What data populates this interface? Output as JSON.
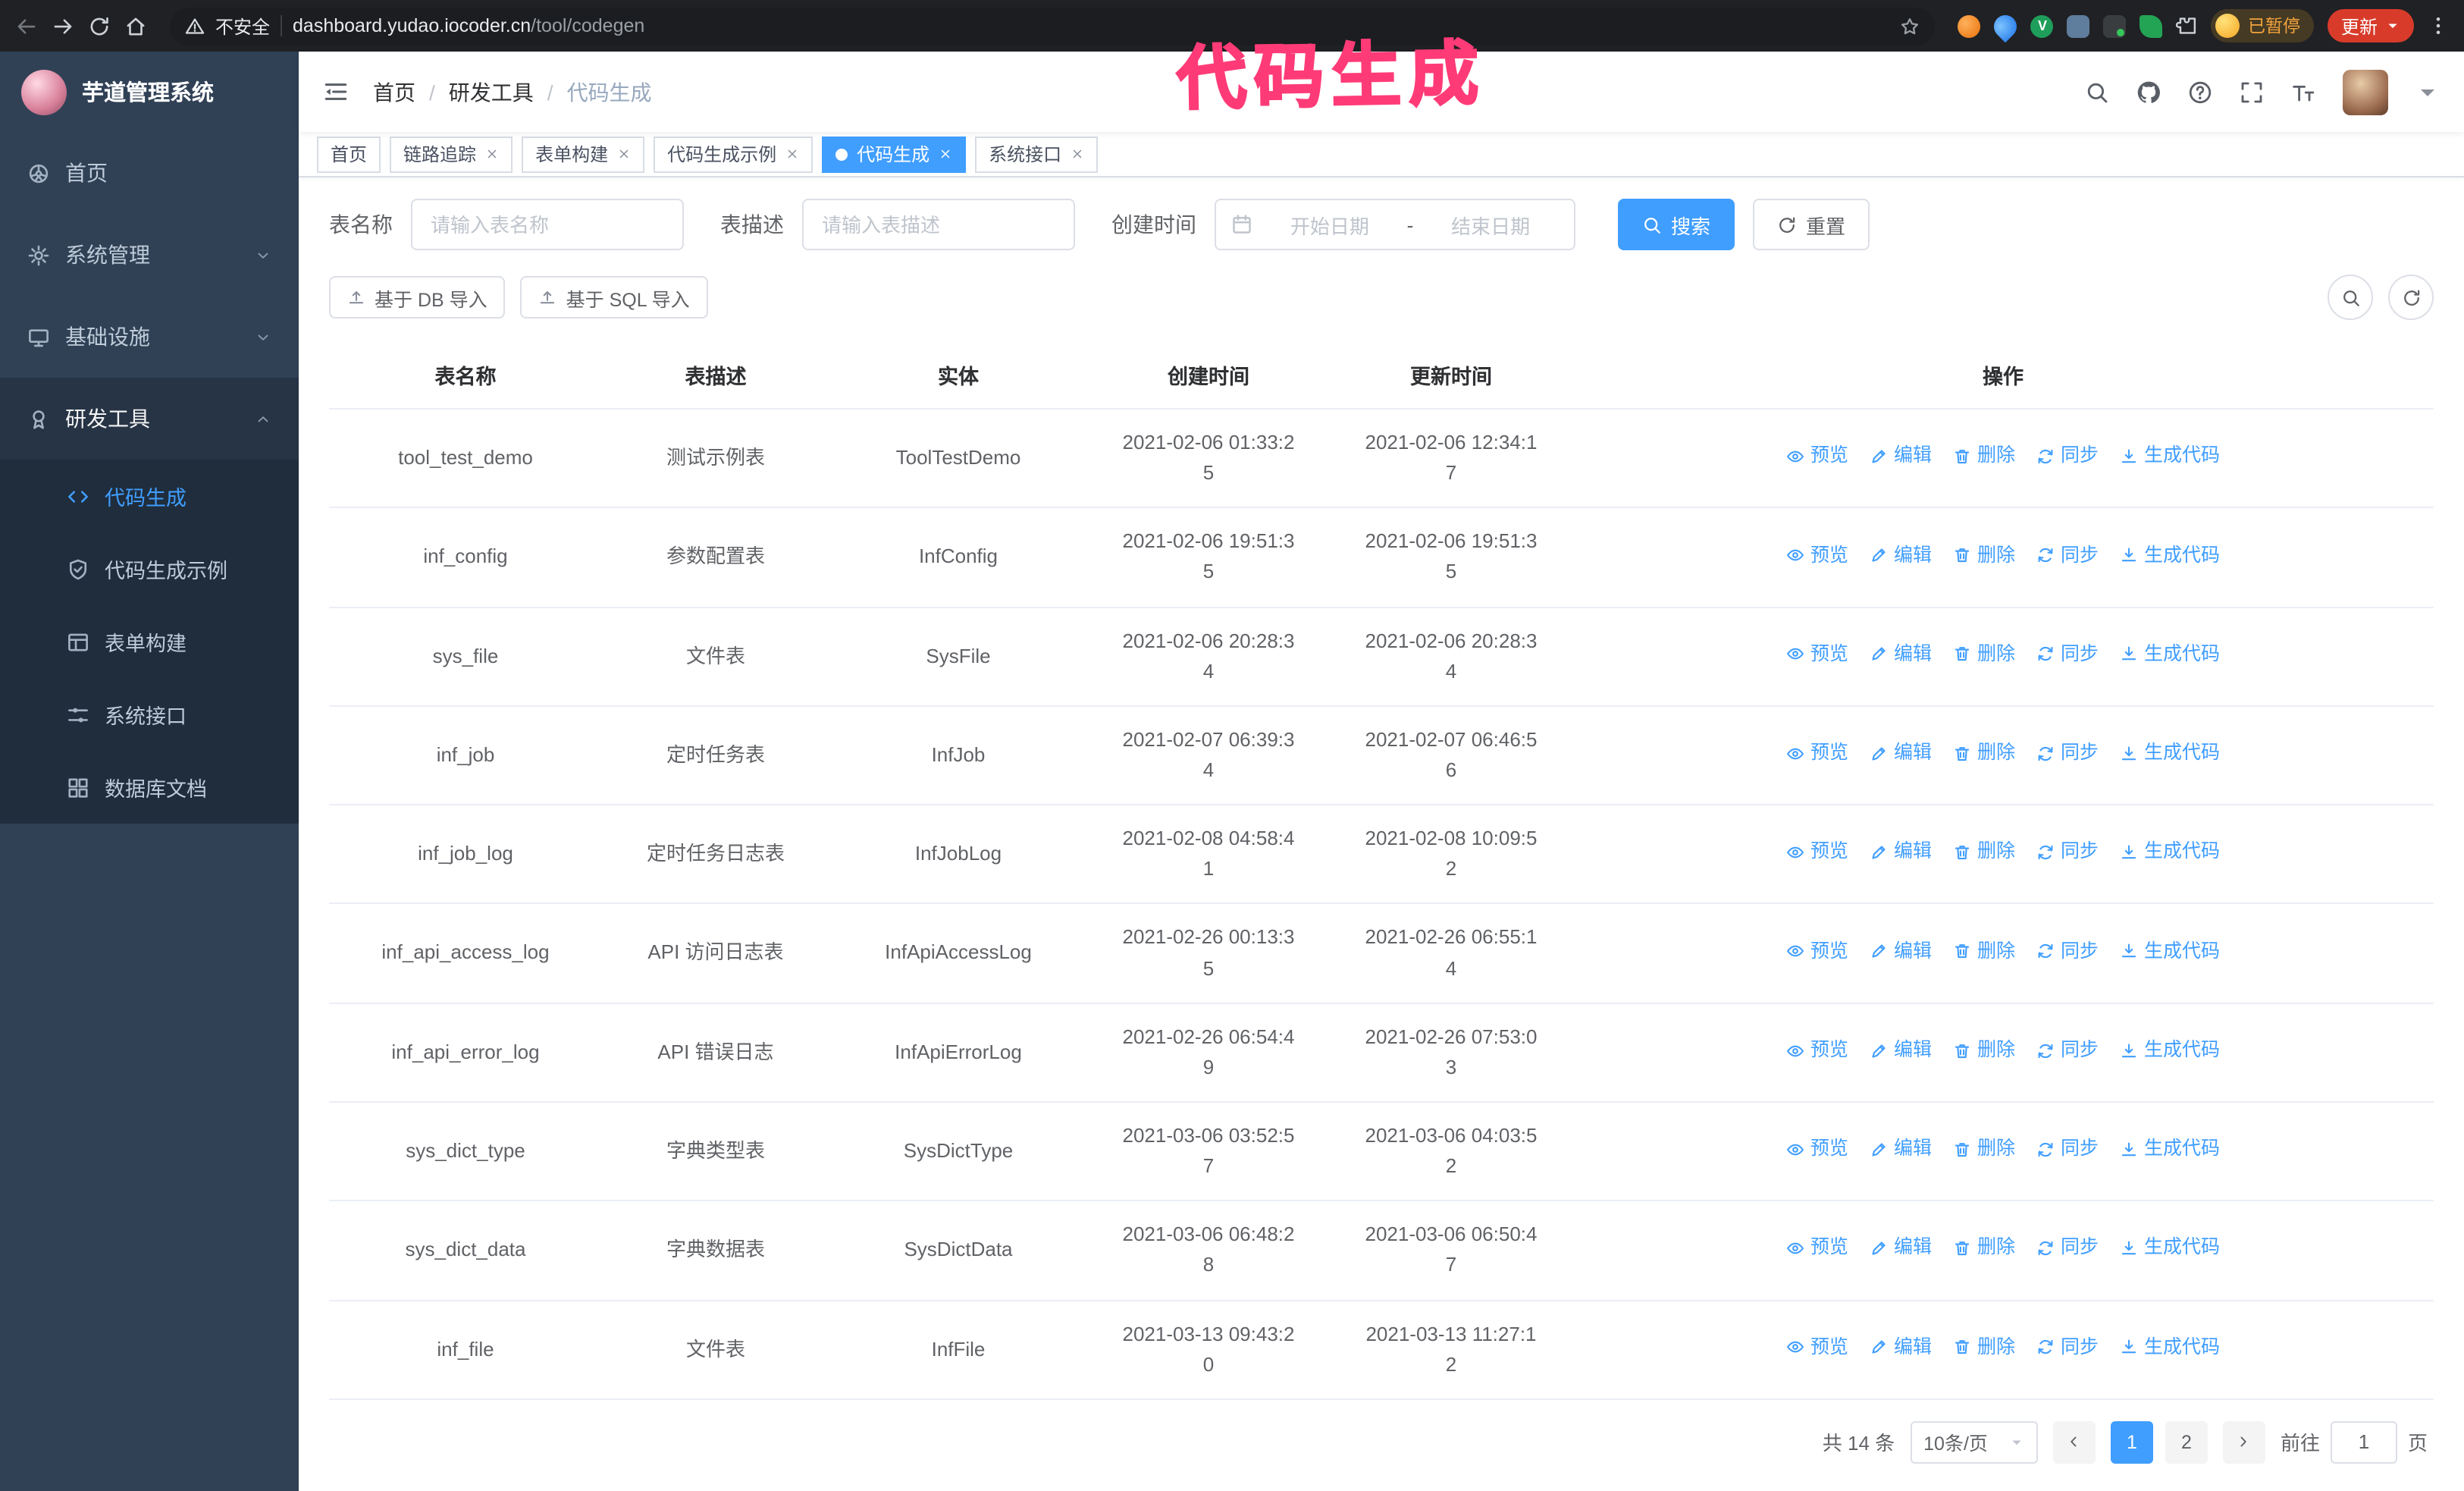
{
  "annotation": {
    "text": "代码生成"
  },
  "browser": {
    "security_label": "不安全",
    "url_host": "dashboard.yudao.iocoder.cn",
    "url_path": "/tool/codegen",
    "paused_badge": "已暂停",
    "update_button": "更新"
  },
  "sidebar": {
    "logo_title": "芋道管理系统",
    "items": [
      {
        "name": "home",
        "label": "首页",
        "icon": "dashboard"
      },
      {
        "name": "system",
        "label": "系统管理",
        "icon": "gear",
        "chevron": "down"
      },
      {
        "name": "infrastructure",
        "label": "基础设施",
        "icon": "monitor",
        "chevron": "down"
      },
      {
        "name": "dev-tools",
        "label": "研发工具",
        "icon": "education",
        "chevron": "up",
        "open": true,
        "children": [
          {
            "name": "codegen",
            "label": "代码生成",
            "icon": "code",
            "active": true
          },
          {
            "name": "codegen-demo",
            "label": "代码生成示例",
            "icon": "shield"
          },
          {
            "name": "form-builder",
            "label": "表单构建",
            "icon": "form"
          },
          {
            "name": "system-api",
            "label": "系统接口",
            "icon": "sliders"
          },
          {
            "name": "db-doc",
            "label": "数据库文档",
            "icon": "grid"
          }
        ]
      }
    ]
  },
  "header": {
    "breadcrumb": [
      "首页",
      "研发工具",
      "代码生成"
    ],
    "separator": "/"
  },
  "tabs": [
    {
      "name": "home",
      "label": "首页",
      "closable": false,
      "active": false
    },
    {
      "name": "tracer",
      "label": "链路追踪",
      "closable": true,
      "active": false
    },
    {
      "name": "form-builder",
      "label": "表单构建",
      "closable": true,
      "active": false
    },
    {
      "name": "codegen-demo",
      "label": "代码生成示例",
      "closable": true,
      "active": false
    },
    {
      "name": "codegen",
      "label": "代码生成",
      "closable": true,
      "active": true
    },
    {
      "name": "system-api",
      "label": "系统接口",
      "closable": true,
      "active": false
    }
  ],
  "filters": {
    "table_name_label": "表名称",
    "table_name_placeholder": "请输入表名称",
    "table_desc_label": "表描述",
    "table_desc_placeholder": "请输入表描述",
    "create_time_label": "创建时间",
    "date_start_placeholder": "开始日期",
    "date_separator": "-",
    "date_end_placeholder": "结束日期",
    "search_button": "搜索",
    "reset_button": "重置"
  },
  "toolbar": {
    "import_db": "基于 DB 导入",
    "import_sql": "基于 SQL 导入"
  },
  "table": {
    "columns": [
      "表名称",
      "表描述",
      "实体",
      "创建时间",
      "更新时间",
      "操作"
    ],
    "actions": [
      {
        "name": "preview",
        "label": "预览",
        "icon": "eye"
      },
      {
        "name": "edit",
        "label": "编辑",
        "icon": "edit"
      },
      {
        "name": "delete",
        "label": "删除",
        "icon": "trash"
      },
      {
        "name": "sync",
        "label": "同步",
        "icon": "sync"
      },
      {
        "name": "generate",
        "label": "生成代码",
        "icon": "download"
      }
    ],
    "rows": [
      {
        "name": "tool_test_demo",
        "desc": "测试示例表",
        "entity": "ToolTestDemo",
        "created": "2021-02-06 01:33:25",
        "updated": "2021-02-06 12:34:17"
      },
      {
        "name": "inf_config",
        "desc": "参数配置表",
        "entity": "InfConfig",
        "created": "2021-02-06 19:51:35",
        "updated": "2021-02-06 19:51:35"
      },
      {
        "name": "sys_file",
        "desc": "文件表",
        "entity": "SysFile",
        "created": "2021-02-06 20:28:34",
        "updated": "2021-02-06 20:28:34"
      },
      {
        "name": "inf_job",
        "desc": "定时任务表",
        "entity": "InfJob",
        "created": "2021-02-07 06:39:34",
        "updated": "2021-02-07 06:46:56"
      },
      {
        "name": "inf_job_log",
        "desc": "定时任务日志表",
        "entity": "InfJobLog",
        "created": "2021-02-08 04:58:41",
        "updated": "2021-02-08 10:09:52"
      },
      {
        "name": "inf_api_access_log",
        "desc": "API 访问日志表",
        "entity": "InfApiAccessLog",
        "created": "2021-02-26 00:13:35",
        "updated": "2021-02-26 06:55:14"
      },
      {
        "name": "inf_api_error_log",
        "desc": "API 错误日志",
        "entity": "InfApiErrorLog",
        "created": "2021-02-26 06:54:49",
        "updated": "2021-02-26 07:53:03"
      },
      {
        "name": "sys_dict_type",
        "desc": "字典类型表",
        "entity": "SysDictType",
        "created": "2021-03-06 03:52:57",
        "updated": "2021-03-06 04:03:52"
      },
      {
        "name": "sys_dict_data",
        "desc": "字典数据表",
        "entity": "SysDictData",
        "created": "2021-03-06 06:48:28",
        "updated": "2021-03-06 06:50:47"
      },
      {
        "name": "inf_file",
        "desc": "文件表",
        "entity": "InfFile",
        "created": "2021-03-13 09:43:20",
        "updated": "2021-03-13 11:27:12"
      }
    ]
  },
  "pagination": {
    "total": "共 14 条",
    "page_size": "10条/页",
    "pages": [
      "1",
      "2"
    ],
    "active_page": "1",
    "goto_label": "前往",
    "goto_value": "1",
    "goto_suffix": "页"
  }
}
